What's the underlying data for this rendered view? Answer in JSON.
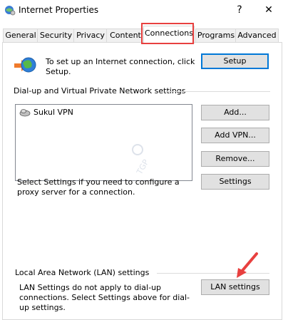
{
  "window": {
    "title": "Internet Properties",
    "help_glyph": "?",
    "close_glyph": "✕"
  },
  "tabs": [
    {
      "label": "General"
    },
    {
      "label": "Security"
    },
    {
      "label": "Privacy"
    },
    {
      "label": "Content"
    },
    {
      "label": "Connections",
      "active": true
    },
    {
      "label": "Programs"
    },
    {
      "label": "Advanced"
    }
  ],
  "setup": {
    "text": "To set up an Internet connection, click Setup.",
    "button": "Setup"
  },
  "vpn": {
    "section_label": "Dial-up and Virtual Private Network settings",
    "items": [
      "Sukul VPN"
    ],
    "add_button": "Add...",
    "add_vpn_button": "Add VPN...",
    "remove_button": "Remove...",
    "settings_button": "Settings",
    "proxy_text": "Select Settings if you need to configure a proxy server for a connection."
  },
  "lan": {
    "section_label": "Local Area Network (LAN) settings",
    "text": "LAN Settings do not apply to dial-up connections. Select Settings above for dial-up settings.",
    "button": "LAN settings"
  },
  "colors": {
    "highlight": "#e8403f",
    "accent": "#0078d7"
  },
  "watermark": "TGP"
}
